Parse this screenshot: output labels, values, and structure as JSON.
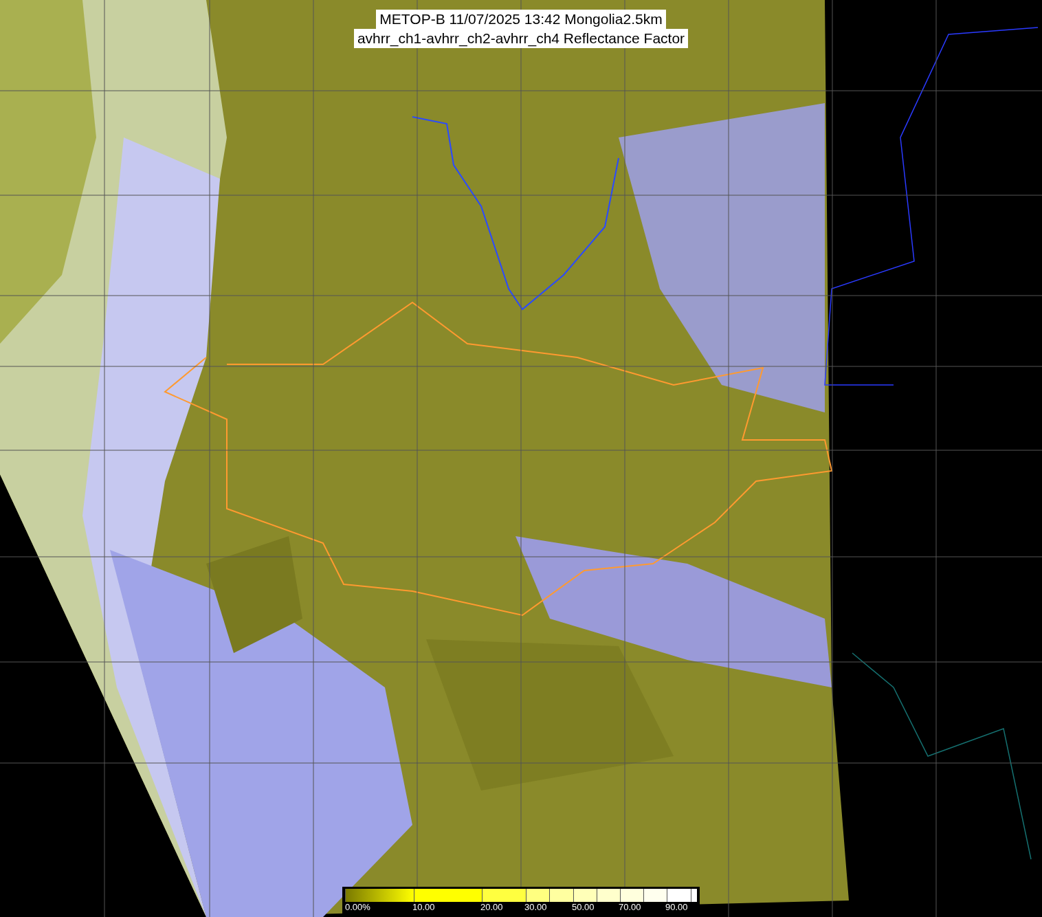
{
  "title": {
    "lines": [
      "METOP-B 11/07/2025 13:42 Mongolia2.5km",
      "avhrr_ch1-avhrr_ch2-avhrr_ch4 Reflectance Factor"
    ]
  },
  "legend": {
    "segments": [
      {
        "kind": "gradient",
        "color": "#7a7a00",
        "label": "0.00%"
      },
      {
        "kind": "solid",
        "color": "#ffff00",
        "label": "10.00"
      },
      {
        "kind": "solid",
        "color": "#ffff40",
        "label": "20.00"
      },
      {
        "kind": "solid",
        "color": "#ffff80",
        "label": "30.00"
      },
      {
        "kind": "solid",
        "color": "#ffffa0"
      },
      {
        "kind": "solid",
        "color": "#ffffb8",
        "label": "50.00"
      },
      {
        "kind": "solid",
        "color": "#ffffcc"
      },
      {
        "kind": "solid",
        "color": "#ffffdd",
        "label": "70.00"
      },
      {
        "kind": "solid",
        "color": "#ffffee"
      },
      {
        "kind": "solid",
        "color": "#ffffff",
        "label": "90.00"
      },
      {
        "kind": "solid",
        "color": "#ffffff"
      }
    ]
  }
}
